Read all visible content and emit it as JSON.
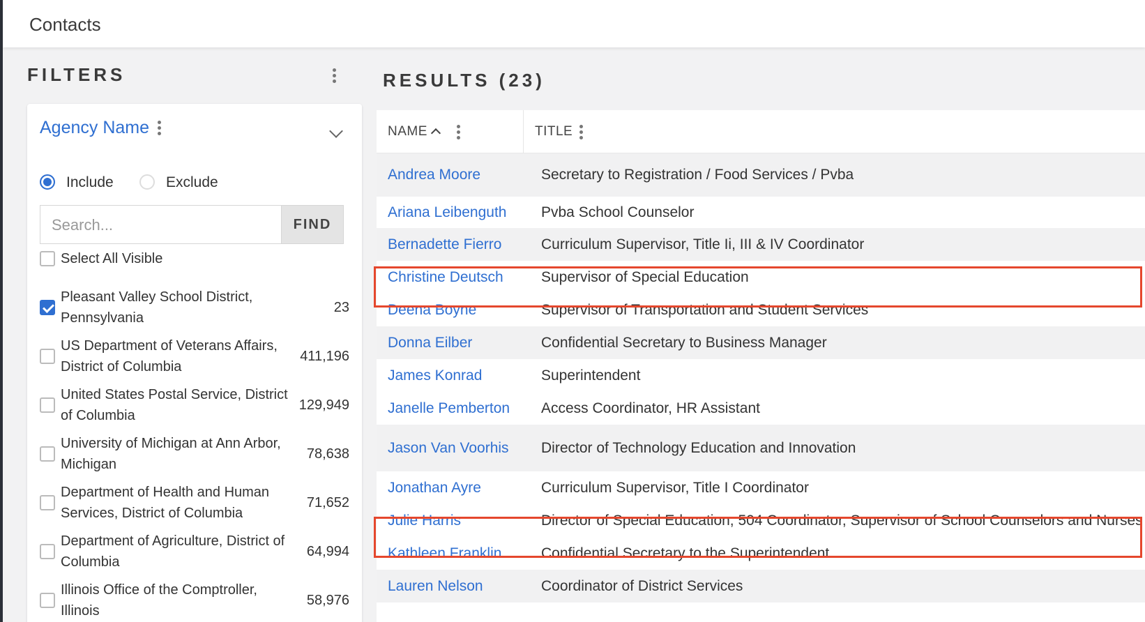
{
  "app": {
    "title": "Contacts"
  },
  "filters": {
    "heading": "FILTERS",
    "agency": {
      "label": "Agency Name",
      "include_label": "Include",
      "exclude_label": "Exclude",
      "search_placeholder": "Search...",
      "find_label": "FIND",
      "select_all_label": "Select All Visible",
      "options": [
        {
          "label": "Pleasant Valley School District, Pennsylvania",
          "count": "23",
          "checked": true
        },
        {
          "label": "US Department of Veterans Affairs, District of Columbia",
          "count": "411,196",
          "checked": false
        },
        {
          "label": "United States Postal Service, District of Columbia",
          "count": "129,949",
          "checked": false
        },
        {
          "label": "University of Michigan at Ann Arbor, Michigan",
          "count": "78,638",
          "checked": false
        },
        {
          "label": "Department of Health and Human Services, District of Columbia",
          "count": "71,652",
          "checked": false
        },
        {
          "label": "Department of Agriculture, District of Columbia",
          "count": "64,994",
          "checked": false
        },
        {
          "label": "Illinois Office of the Comptroller, Illinois",
          "count": "58,976",
          "checked": false
        }
      ]
    }
  },
  "results": {
    "heading": "RESULTS (23)",
    "columns": {
      "name": "NAME",
      "title": "TITLE"
    },
    "rows": [
      {
        "name": "Andrea Moore",
        "title": "Secretary to Registration / Food Services / Pvba"
      },
      {
        "name": "Ariana Leibenguth",
        "title": "Pvba School Counselor"
      },
      {
        "name": "Bernadette Fierro",
        "title": "Curriculum Supervisor, Title Ii, III & IV Coordinator"
      },
      {
        "name": "Christine Deutsch",
        "title": "Supervisor of Special Education"
      },
      {
        "name": "Deena Boyne",
        "title": "Supervisor of Transportation and Student Services"
      },
      {
        "name": "Donna Eilber",
        "title": "Confidential Secretary to Business Manager"
      },
      {
        "name": "James Konrad",
        "title": "Superintendent"
      },
      {
        "name": "Janelle Pemberton",
        "title": "Access Coordinator, HR Assistant"
      },
      {
        "name": "Jason Van Voorhis",
        "title": "Director of Technology Education and Innovation"
      },
      {
        "name": "Jonathan Ayre",
        "title": "Curriculum Supervisor, Title I Coordinator"
      },
      {
        "name": "Julie Harris",
        "title": "Director of Special Education, 504 Coordinator, Supervisor of School Counselors and Nurses"
      },
      {
        "name": "Kathleen Franklin",
        "title": "Confidential Secretary to the Superintendent"
      },
      {
        "name": "Lauren Nelson",
        "title": "Coordinator of District Services"
      }
    ]
  },
  "colors": {
    "accent": "#2f6fd1",
    "highlight": "#e5472d"
  }
}
